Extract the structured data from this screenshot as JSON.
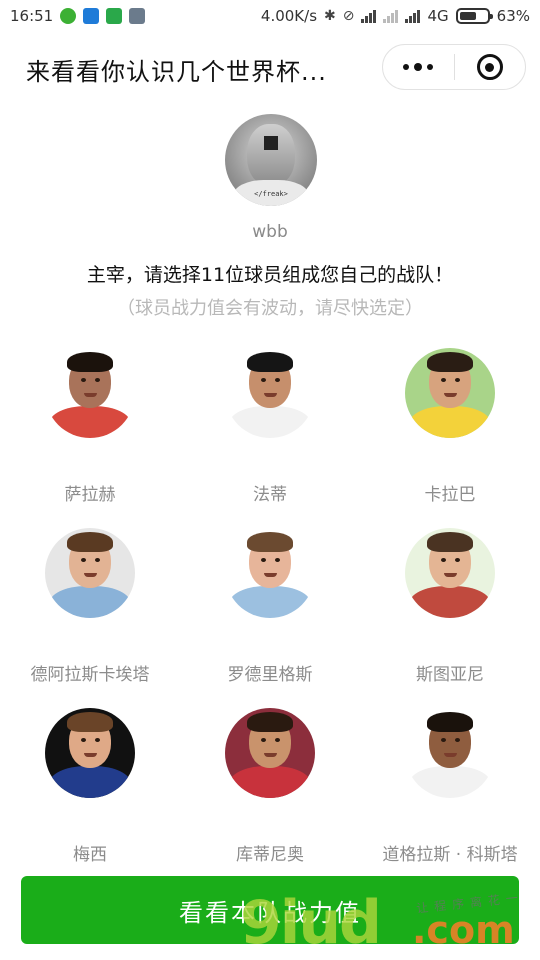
{
  "status_bar": {
    "time": "16:51",
    "net_speed": "4.00K/s",
    "network": "4G",
    "battery_text": "63%",
    "battery_level": 0.63,
    "icons": [
      "wechat-icon",
      "app-icon",
      "app-icon",
      "app-icon",
      "bluetooth-icon",
      "mute-icon",
      "signal-icon",
      "signal-icon",
      "battery-icon"
    ]
  },
  "header": {
    "title": "来看看你认识几个世界杯...",
    "more_icon": "more-dots-icon",
    "close_icon": "close-target-icon"
  },
  "user": {
    "name": "wbb",
    "avatar_tag": "</freak>"
  },
  "instruction": "主宰，请选择11位球员组成您自己的战队！",
  "hint": "（球员战力值会有波动，请尽快选定）",
  "players": [
    {
      "name": "萨拉赫",
      "skin": "#a9735a",
      "hair": "#1b120c",
      "shirt": "#d8493e",
      "bg": "#ffffff"
    },
    {
      "name": "法蒂",
      "skin": "#c68f6c",
      "hair": "#151515",
      "shirt": "#f2f2f2",
      "bg": "#ffffff"
    },
    {
      "name": "卡拉巴",
      "skin": "#d7a37e",
      "hair": "#2a1d14",
      "shirt": "#f3d23a",
      "bg": "#a9d489"
    },
    {
      "name": "德阿拉斯卡埃塔",
      "skin": "#e2b394",
      "hair": "#5a3a22",
      "shirt": "#8ab2d8",
      "bg": "#e6e6e6"
    },
    {
      "name": "罗德里格斯",
      "skin": "#e7b59a",
      "hair": "#6b4a30",
      "shirt": "#9cc0e0",
      "bg": "#ffffff"
    },
    {
      "name": "斯图亚尼",
      "skin": "#e4b594",
      "hair": "#4a3322",
      "shirt": "#c04a3e",
      "bg": "#e9f3df"
    },
    {
      "name": "梅西",
      "skin": "#dfa987",
      "hair": "#6a4428",
      "shirt": "#223c8c",
      "bg": "#111111"
    },
    {
      "name": "库蒂尼奥",
      "skin": "#c9936c",
      "hair": "#2a1a10",
      "shirt": "#c8323c",
      "bg": "#8c2e3c"
    },
    {
      "name": "道格拉斯 · 科斯塔",
      "skin": "#8f5d3f",
      "hair": "#1a120c",
      "shirt": "#f2f2f2",
      "bg": "#ffffff"
    }
  ],
  "cta": {
    "label": "看看本队战力值"
  },
  "watermark": {
    "number": "9iud",
    "suffix": ".com",
    "script": "让程序离花一"
  }
}
